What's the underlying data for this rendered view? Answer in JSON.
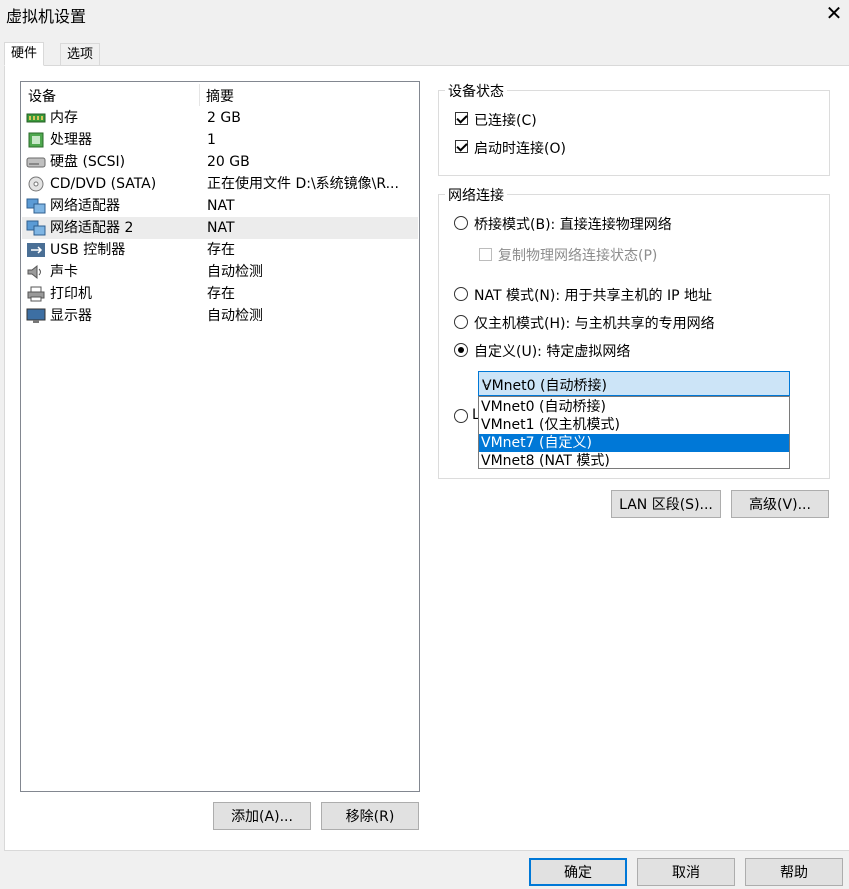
{
  "window": {
    "title": "虚拟机设置",
    "close": "✕"
  },
  "tabs": [
    {
      "label": "硬件"
    },
    {
      "label": "选项"
    }
  ],
  "device_list": {
    "headers": {
      "device": "设备",
      "summary": "摘要"
    },
    "rows": [
      {
        "name": "内存",
        "summary": "2 GB",
        "icon": "memory-icon"
      },
      {
        "name": "处理器",
        "summary": "1",
        "icon": "cpu-icon"
      },
      {
        "name": "硬盘 (SCSI)",
        "summary": "20 GB",
        "icon": "disk-icon"
      },
      {
        "name": "CD/DVD (SATA)",
        "summary": "正在使用文件 D:\\系统镜像\\R...",
        "icon": "cd-icon"
      },
      {
        "name": "网络适配器",
        "summary": "NAT",
        "icon": "network-icon"
      },
      {
        "name": "网络适配器 2",
        "summary": "NAT",
        "icon": "network-icon",
        "selected": true
      },
      {
        "name": "USB 控制器",
        "summary": "存在",
        "icon": "usb-icon"
      },
      {
        "name": "声卡",
        "summary": "自动检测",
        "icon": "speaker-icon"
      },
      {
        "name": "打印机",
        "summary": "存在",
        "icon": "printer-icon"
      },
      {
        "name": "显示器",
        "summary": "自动检测",
        "icon": "monitor-icon"
      }
    ]
  },
  "buttons": {
    "add": "添加(A)...",
    "remove": "移除(R)",
    "lan": "LAN 区段(S)...",
    "advanced": "高级(V)...",
    "ok": "确定",
    "cancel": "取消",
    "help": "帮助"
  },
  "device_status": {
    "label": "设备状态",
    "connected": "已连接(C)",
    "connect_on_power": "启动时连接(O)"
  },
  "network": {
    "label": "网络连接",
    "bridged": "桥接模式(B): 直接连接物理网络",
    "replicate": "复制物理网络连接状态(P)",
    "nat": "NAT 模式(N): 用于共享主机的 IP 地址",
    "host_only": "仅主机模式(H): 与主机共享的专用网络",
    "custom": "自定义(U): 特定虚拟网络",
    "hidden_radio_letter": "L",
    "combo_value": "VMnet0 (自动桥接)",
    "options": [
      "VMnet0 (自动桥接)",
      "VMnet1 (仅主机模式)",
      "VMnet7 (自定义)",
      "VMnet8 (NAT 模式)"
    ],
    "selected_option": 2
  }
}
